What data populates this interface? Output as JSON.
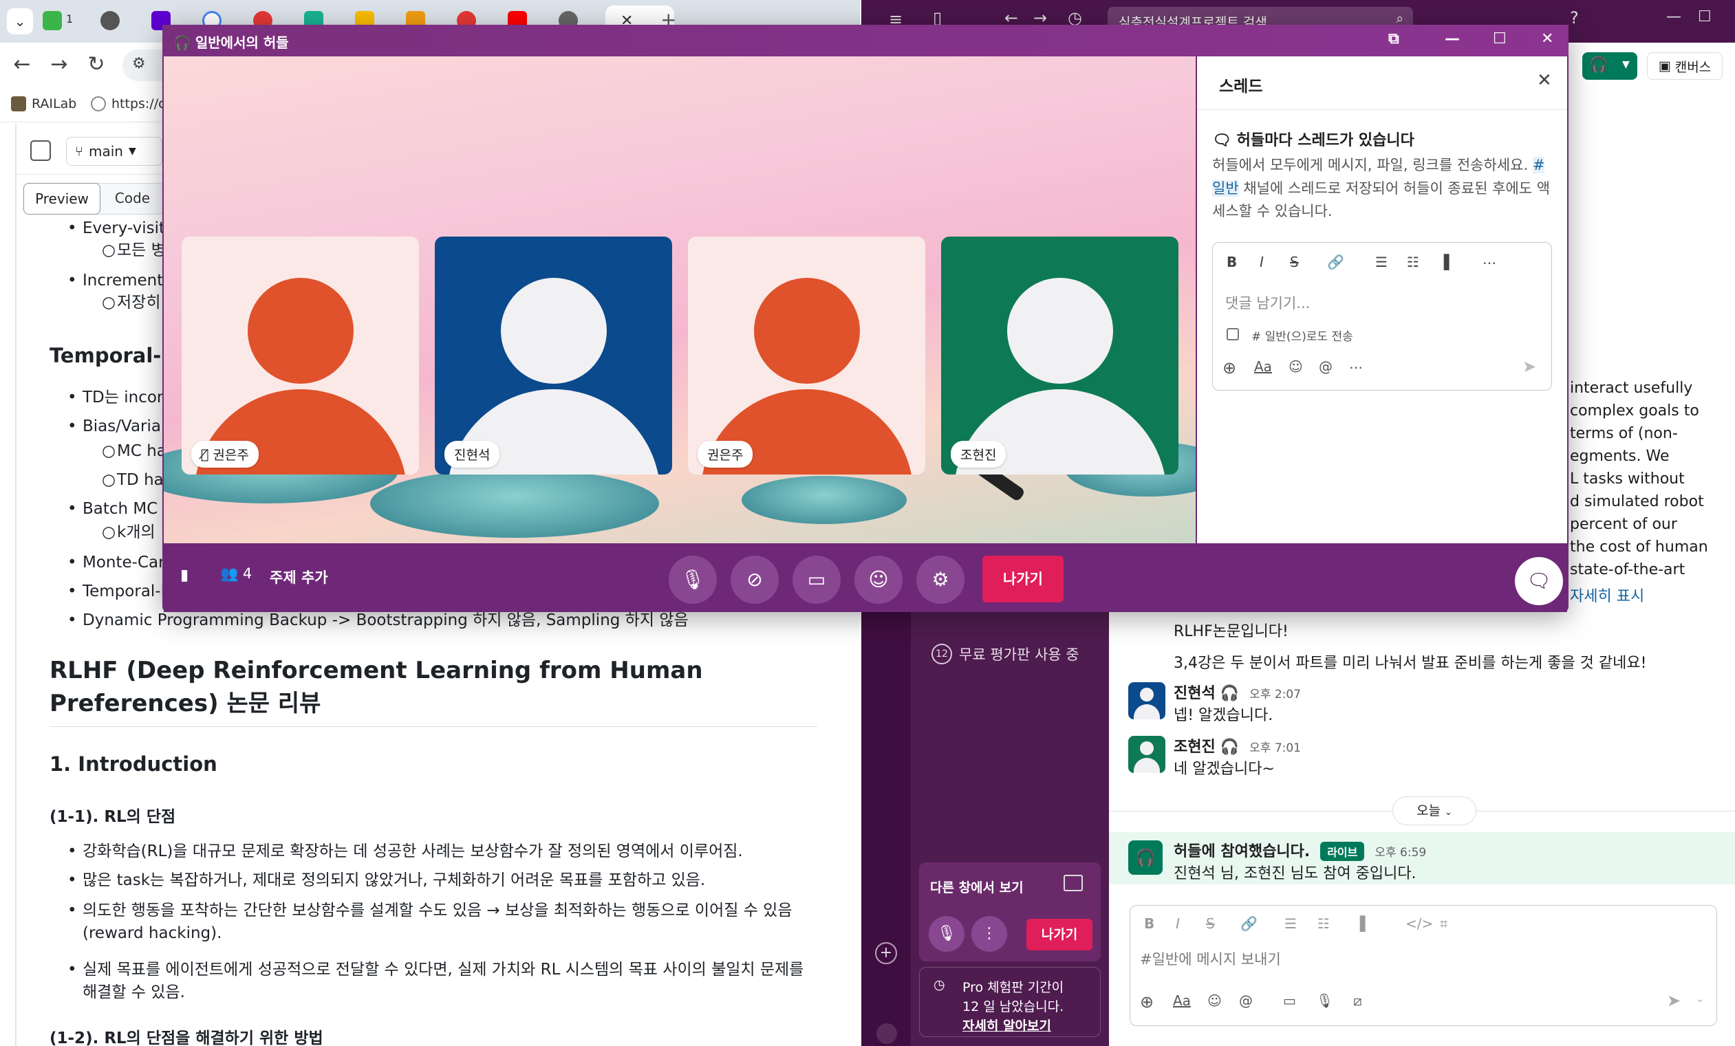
{
  "browser": {
    "tab_count_badge": "1",
    "bookmarks": [
      {
        "label": "RAILab"
      },
      {
        "label": "https://c"
      }
    ],
    "repo": {
      "branch": "main",
      "tab_preview": "Preview",
      "tab_code": "Code"
    },
    "doc": {
      "items_top": [
        {
          "text": "Every-visit",
          "level": 1
        },
        {
          "text": "모든 병",
          "level": 2
        },
        {
          "text": "Incrementa",
          "level": 1
        },
        {
          "text": "저장히",
          "level": 2
        }
      ],
      "section_temporal": "Temporal-D",
      "items_mid": [
        {
          "text": "TD는 incon",
          "level": 1
        },
        {
          "text": "Bias/Varian",
          "level": 1
        },
        {
          "text": "MC ha",
          "level": 2
        },
        {
          "text": "TD has",
          "level": 2
        },
        {
          "text": "Batch MC a",
          "level": 1
        },
        {
          "text": "k개의",
          "level": 2
        },
        {
          "text": "Monte-Car",
          "level": 1
        },
        {
          "text": "Temporal-D",
          "level": 1
        },
        {
          "text": "Dynamic Programming Backup -> Bootstrapping 하지 않음, Sampling 하지 않음",
          "level": 1
        }
      ],
      "rlhf_title": "RLHF (Deep Reinforcement Learning from Human Preferences) 논문 리뷰",
      "intro_heading": "1. Introduction",
      "sub_1_1": "(1-1). RL의 단점",
      "bullets_1_1": [
        "강화학습(RL)을 대규모 문제로 확장하는 데 성공한 사례는 보상함수가 잘 정의된 영역에서 이루어짐.",
        "많은 task는 복잡하거나, 제대로 정의되지 않았거나, 구체화하기 어려운 목표를 포함하고 있음.",
        "의도한 행동을 포착하는 간단한 보상함수를 설계할 수도 있음 → 보상을 최적화하는 행동으로 이어질 수 있음(reward hacking).",
        "실제 목표를 에이전트에게 성공적으로 전달할 수 있다면, 실제 가치와 RL 시스템의 목표 사이의 불일치 문제를 해결할 수 있음."
      ],
      "sub_1_2": "(1-2). RL의 단점을 해결하기 위한 방법"
    }
  },
  "slack": {
    "search_placeholder": "심층전실설계프로젝트 검색",
    "canvas_label": "캔버스",
    "trial_count": "12",
    "trial_label": "무료 평가판 사용 중",
    "paper_snippets": [
      "interact usefully",
      "complex goals to",
      "terms of (non-",
      "egments. We",
      "L tasks without",
      "d simulated robot",
      "percent of our",
      "the cost of human",
      "state-of-the-art"
    ],
    "show_more": "자세히 표시",
    "messages": [
      {
        "text": "RLHF논문입니다!"
      },
      {
        "text": "3,4강은 두 분이서 파트를 미리 나눠서 발표 준비를 하는게 좋을 것 같네요!"
      },
      {
        "name": "진현석",
        "time": "오후 2:07",
        "text": "넵! 알겠습니다."
      },
      {
        "name": "조현진",
        "time": "오후 7:01",
        "text": "네 알겠습니다~"
      }
    ],
    "today_label": "오늘",
    "huddle_event": {
      "title": "허들에 참여했습니다.",
      "badge": "라이브",
      "time": "오후 6:59",
      "detail": "진현석 님, 조현진 님도 참여 중입니다."
    },
    "compose_placeholder": "#일반에 메시지 보내기",
    "mini_huddle": {
      "title": "다른 창에서 보기",
      "leave": "나가기"
    },
    "pro_box": {
      "line1": "Pro 체험판 기간이",
      "line2": "12 일 남았습니다.",
      "link": "자세히 알아보기"
    }
  },
  "huddle": {
    "window_title": "일반에서의 허들",
    "participants": [
      {
        "name": "권은주",
        "muted": true,
        "bg": "#fbe9e7",
        "fg": "#e0522b"
      },
      {
        "name": "진현석",
        "muted": false,
        "bg": "#0b4a8c",
        "fg": "#f1f1f4"
      },
      {
        "name": "권은주",
        "muted": false,
        "bg": "#fbe9e7",
        "fg": "#e0522b"
      },
      {
        "name": "조현진",
        "muted": false,
        "bg": "#0e7a55",
        "fg": "#f1f1f4"
      }
    ],
    "people_count": "4",
    "add_topic": "주제 추가",
    "leave": "나가기",
    "thread": {
      "title": "스레드",
      "heading": "허들마다 스레드가 있습니다",
      "body_part1": "허들에서 모두에게 메시지, 파일, 링크를 전송하세요.",
      "channel_tag": "#일반",
      "body_part2": "채널에 스레드로 저장되어 허들이 종료된 후에도 액세스할 수 있습니다.",
      "placeholder": "댓글 남기기...",
      "also_send": "# 일반(으)로도 전송"
    }
  }
}
